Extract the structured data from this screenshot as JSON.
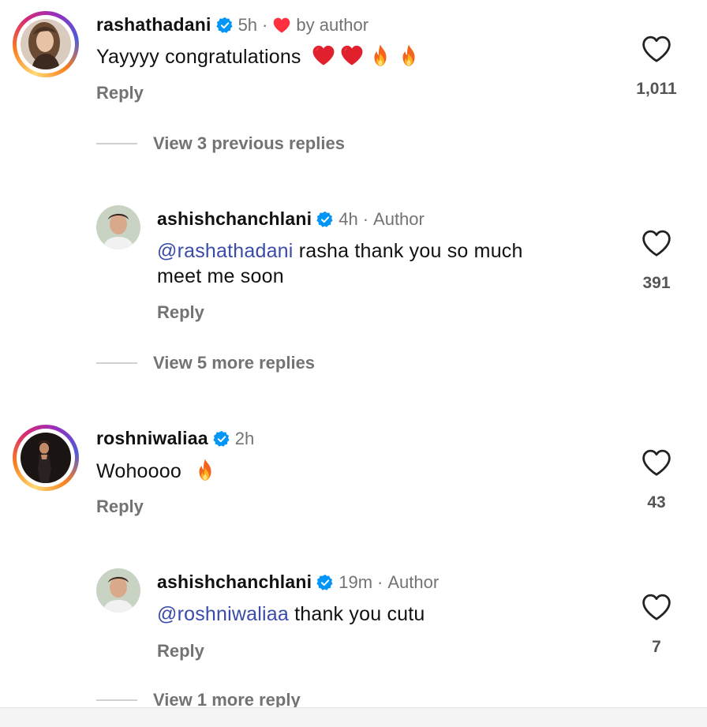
{
  "comments": [
    {
      "username": "rashathadani",
      "time": "5h",
      "separator": "·",
      "liked_by": "by author",
      "text": "Yayyyy congratulations",
      "emojis": [
        "heart",
        "heart",
        "fire",
        "fire"
      ],
      "reply_label": "Reply",
      "likes": "1,011"
    },
    {
      "view_label": "View 3 previous replies"
    },
    {
      "username": "ashishchanchlani",
      "time": "4h",
      "separator": "·",
      "author_badge": "Author",
      "mention": "@rashathadani",
      "text_line1": " rasha thank you so much",
      "text_line2": "meet me soon",
      "reply_label": "Reply",
      "likes": "391"
    },
    {
      "view_label": "View 5 more replies"
    },
    {
      "username": "roshniwaliaa",
      "time": "2h",
      "text": "Wohoooo",
      "emojis": [
        "fire"
      ],
      "reply_label": "Reply",
      "likes": "43"
    },
    {
      "username": "ashishchanchlani",
      "time": "19m",
      "separator": "·",
      "author_badge": "Author",
      "mention": "@roshniwaliaa",
      "text": " thank you cutu",
      "reply_label": "Reply",
      "likes": "7"
    },
    {
      "view_label": "View 1 more reply"
    }
  ],
  "colors": {
    "verified": "#0095f6",
    "heart": "#ff3040",
    "mention": "#3a4ba8",
    "muted": "#737373"
  },
  "icons": {
    "verified": "verified-badge-icon",
    "like": "heart-outline-icon",
    "liked_by_author": "heart-filled-icon",
    "emoji_heart": "red-heart-emoji",
    "emoji_fire": "fire-emoji"
  }
}
